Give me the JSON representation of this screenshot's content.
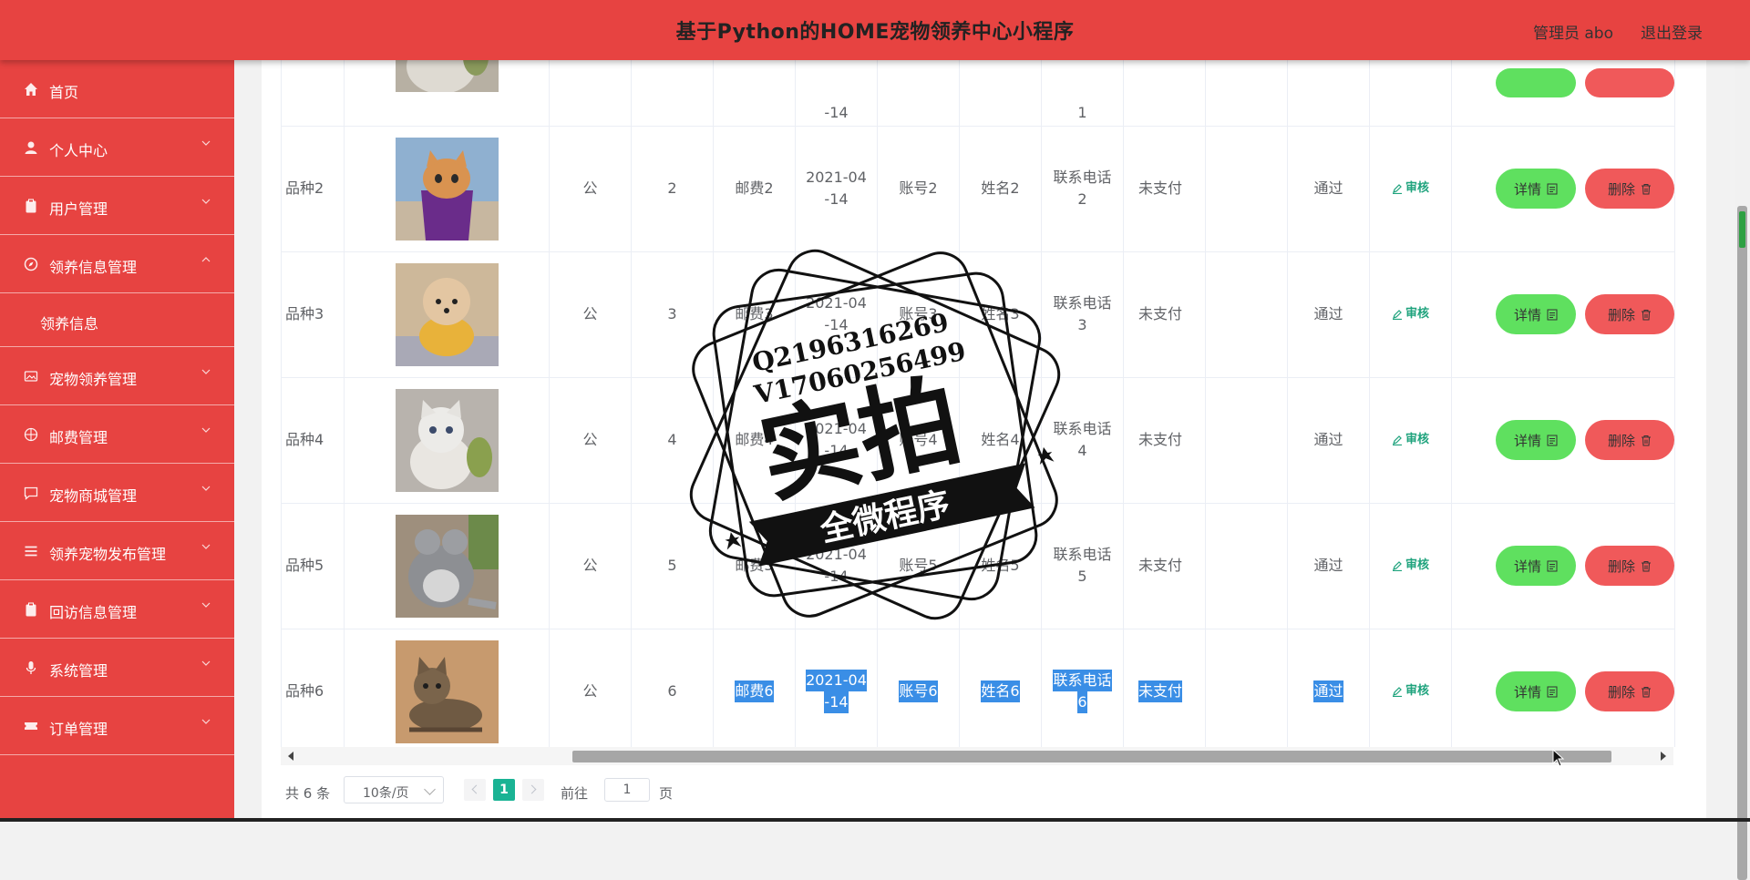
{
  "header": {
    "title": "基于Python的HOME宠物领养中心小程序",
    "user": "管理员 abo",
    "logout": "退出登录"
  },
  "sidebar": {
    "items": [
      {
        "label": "首页",
        "icon": "home-icon"
      },
      {
        "label": "个人中心",
        "icon": "user-icon"
      },
      {
        "label": "用户管理",
        "icon": "clipboard-icon"
      },
      {
        "label": "领养信息管理",
        "icon": "compass-icon"
      },
      {
        "label": "领养信息",
        "icon": ""
      },
      {
        "label": "宠物领养管理",
        "icon": "picture-icon"
      },
      {
        "label": "邮费管理",
        "icon": "target-icon"
      },
      {
        "label": "宠物商城管理",
        "icon": "chat-icon"
      },
      {
        "label": "领养宠物发布管理",
        "icon": "menu-icon"
      },
      {
        "label": "回访信息管理",
        "icon": "clipboard-icon"
      },
      {
        "label": "系统管理",
        "icon": "mic-icon"
      },
      {
        "label": "订单管理",
        "icon": "ticket-icon"
      }
    ]
  },
  "top_row": {
    "date": "-14",
    "phone": "1"
  },
  "rows": [
    {
      "breed": "品种2",
      "gender": "公",
      "num": "2",
      "fee": "邮费2",
      "date_a": "2021-04",
      "date_b": "-14",
      "account": "账号2",
      "name": "姓名2",
      "phone_a": "联系电话",
      "phone_b": "2",
      "pay": "未支付",
      "status": "通过",
      "audit": "审核",
      "detail": "详情",
      "delete": "删除",
      "image": "orange cat in purple gift bag"
    },
    {
      "breed": "品种3",
      "gender": "公",
      "num": "3",
      "fee": "邮费3",
      "date_a": "2021-04",
      "date_b": "-14",
      "account": "账号3",
      "name": "姓名3",
      "phone_a": "联系电话",
      "phone_b": "3",
      "pay": "未支付",
      "status": "通过",
      "audit": "审核",
      "detail": "详情",
      "delete": "删除",
      "image": "poodle in yellow shirt"
    },
    {
      "breed": "品种4",
      "gender": "公",
      "num": "4",
      "fee": "邮费4",
      "date_a": "2021-04",
      "date_b": "-14",
      "account": "账号4",
      "name": "姓名4",
      "phone_a": "联系电话",
      "phone_b": "4",
      "pay": "未支付",
      "status": "通过",
      "audit": "审核",
      "detail": "详情",
      "delete": "删除",
      "image": "grey kitten with toy"
    },
    {
      "breed": "品种5",
      "gender": "公",
      "num": "5",
      "fee": "邮费5",
      "date_a": "2021-04",
      "date_b": "-14",
      "account": "账号5",
      "name": "姓名5",
      "phone_a": "联系电话",
      "phone_b": "5",
      "pay": "未支付",
      "status": "通过",
      "audit": "审核",
      "detail": "详情",
      "delete": "删除",
      "image": "grey chinchilla"
    },
    {
      "breed": "品种6",
      "gender": "公",
      "num": "6",
      "fee": "邮费6",
      "date_a": "2021-04",
      "date_b": "-14",
      "account": "账号6",
      "name": "姓名6",
      "phone_a": "联系电话",
      "phone_b": "6",
      "pay": "未支付",
      "status": "通过",
      "audit": "审核",
      "detail": "详情",
      "delete": "删除",
      "image": "tabby cat lying"
    }
  ],
  "pager": {
    "total": "共 6 条",
    "page_size": "10条/页",
    "current": "1",
    "goto_label": "前往",
    "goto_value": "1",
    "goto_unit": "页"
  },
  "watermark": {
    "line1": "Q2196316269",
    "line2": "V17060256499",
    "main": "实拍",
    "banner": "全微程序"
  },
  "colors": {
    "header_bg": "#e74341",
    "sidebar_bg": "#e74341",
    "detail_btn": "#5fe05f",
    "delete_btn": "#f0595a",
    "audit_text": "#1fa37d",
    "page_active": "#1ab394",
    "selection": "#3a8ee6"
  }
}
